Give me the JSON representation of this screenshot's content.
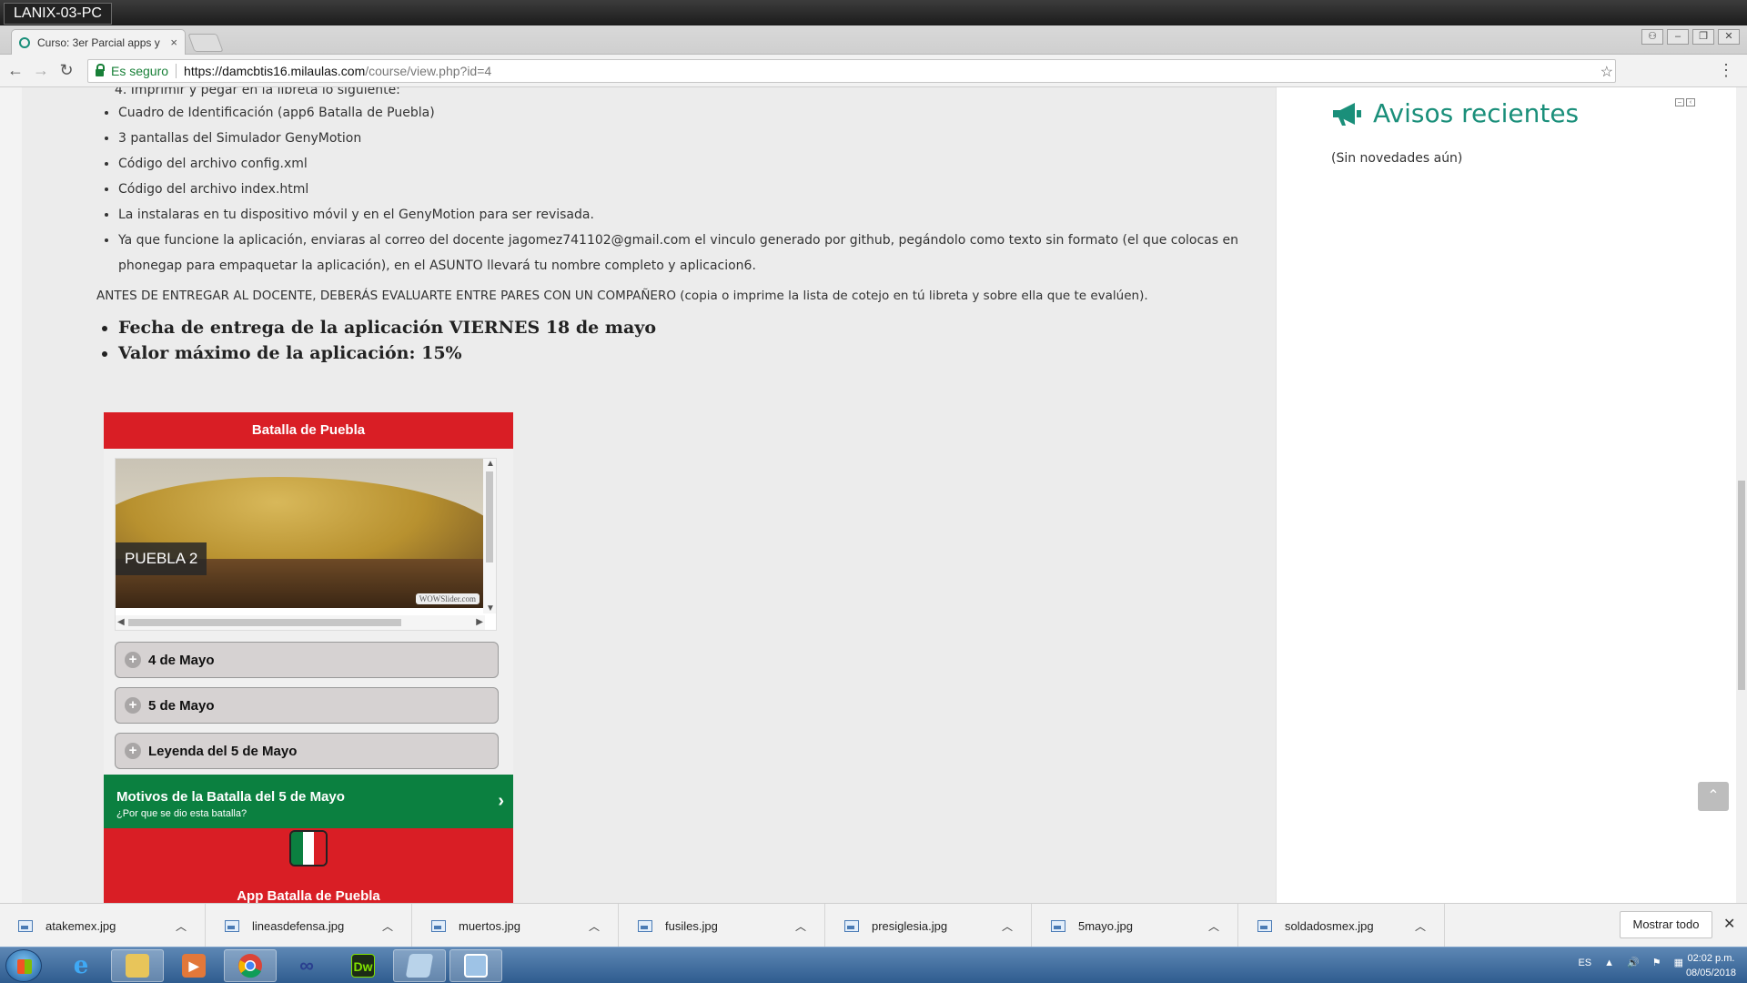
{
  "window": {
    "pc_name": "LANIX-03-PC"
  },
  "tab": {
    "title": "Curso: 3er Parcial apps y",
    "close": "×"
  },
  "address": {
    "secure_label": "Es seguro",
    "url_host": "https://damcbtis16.milaulas.com",
    "url_path": "/course/view.php?id=4"
  },
  "content": {
    "cut_line": "4. Imprimir y pegar en la libreta lo siguiente:",
    "items": [
      "Cuadro de Identificación (app6 Batalla de Puebla)",
      "3 pantallas del Simulador GenyMotion",
      "Código del archivo config.xml",
      "Código del archivo index.html",
      "La instalaras en tu dispositivo móvil y en el GenyMotion para ser revisada.",
      "Ya que funcione la aplicación, enviaras al correo del docente jagomez741102@gmail.com el vinculo generado por github, pegándolo como texto sin formato (el que colocas en phonegap para empaquetar la aplicación), en el ASUNTO llevará tu nombre completo y aplicacion6."
    ],
    "paragraph": "ANTES DE ENTREGAR AL DOCENTE, DEBERÁS EVALUARTE ENTRE PARES CON UN COMPAÑERO (copia o imprime la lista de cotejo en tú libreta y sobre ella que te evalúen).",
    "big_items": [
      "Fecha de entrega de la aplicación VIERNES  18 de mayo",
      "Valor máximo de la aplicación: 15%"
    ]
  },
  "app": {
    "header": "Batalla de Puebla",
    "slide_label": "PUEBLA 2",
    "watermark": "WOWSlider.com",
    "collapsibles": [
      "4 de Mayo",
      "5 de Mayo",
      "Leyenda del 5 de Mayo"
    ],
    "motivos_title": "Motivos de la Batalla del 5 de Mayo",
    "motivos_sub": "¿Por que se dio esta batalla?",
    "footer_title": "App  Batalla de Puebla"
  },
  "sidebar": {
    "title": "Avisos recientes",
    "empty_text": "(Sin novedades aún)"
  },
  "downloads": {
    "files": [
      "atakemex.jpg",
      "lineasdefensa.jpg",
      "muertos.jpg",
      "fusiles.jpg",
      "presiglesia.jpg",
      "5mayo.jpg",
      "soldadosmex.jpg"
    ],
    "show_all": "Mostrar todo"
  },
  "taskbar": {
    "lang": "ES",
    "time": "02:02 p.m.",
    "date": "08/05/2018"
  },
  "colors": {
    "accent": "#1a8f7a",
    "app_red": "#d91e25",
    "app_green": "#0b8040"
  }
}
